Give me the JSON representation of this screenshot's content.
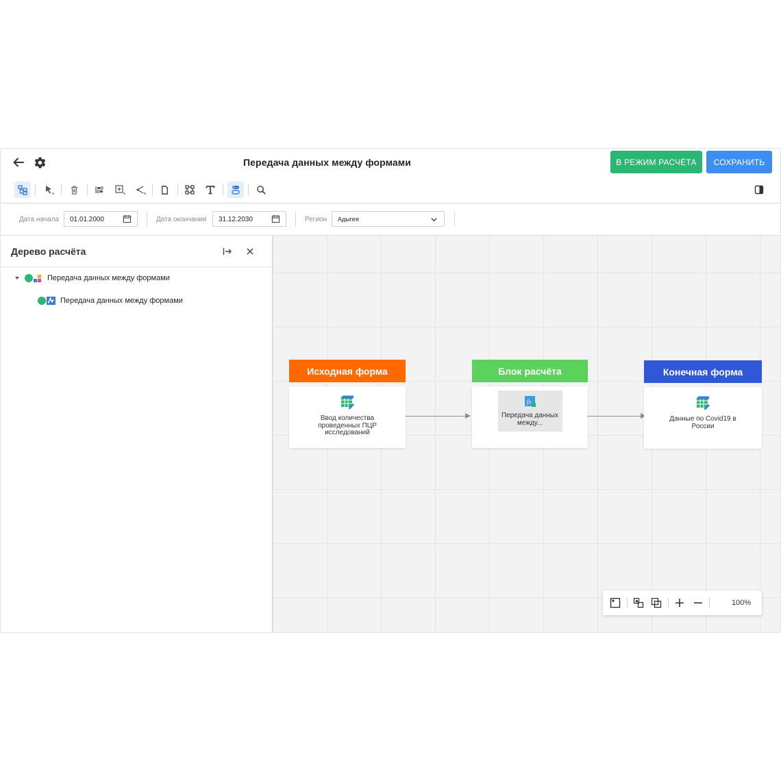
{
  "header": {
    "title": "Передача данных между формами",
    "calc_mode_button": "В РЕЖИМ РАСЧЁТА",
    "save_button": "СОХРАНИТЬ"
  },
  "filters": {
    "start_date_label": "Дата начала",
    "start_date_value": "01.01.2000",
    "end_date_label": "Дата окончания",
    "end_date_value": "31.12.2030",
    "region_label": "Регион",
    "region_value": "Адыгея"
  },
  "tree": {
    "title": "Дерево расчёта",
    "items": [
      {
        "label": "Передача данных между формами",
        "level": 0,
        "expanded": true
      },
      {
        "label": "Передача данных между формами",
        "level": 1
      }
    ]
  },
  "diagram": {
    "nodes": [
      {
        "header": "Исходная форма",
        "text": "Ввод количества проведенных ПЦР исследований",
        "color": "#ff6a00"
      },
      {
        "header": "Блок расчёта",
        "text": "Передача данных между...",
        "color": "#5bd25b"
      },
      {
        "header": "Конечная форма",
        "text": "Данные по Covid19 в России",
        "color": "#2f57d8"
      }
    ]
  },
  "zoom": {
    "value": "100%"
  },
  "colors": {
    "green_button": "#2bb673",
    "blue_button": "#3d8ef2",
    "accent_blue": "#3d7bd9"
  }
}
